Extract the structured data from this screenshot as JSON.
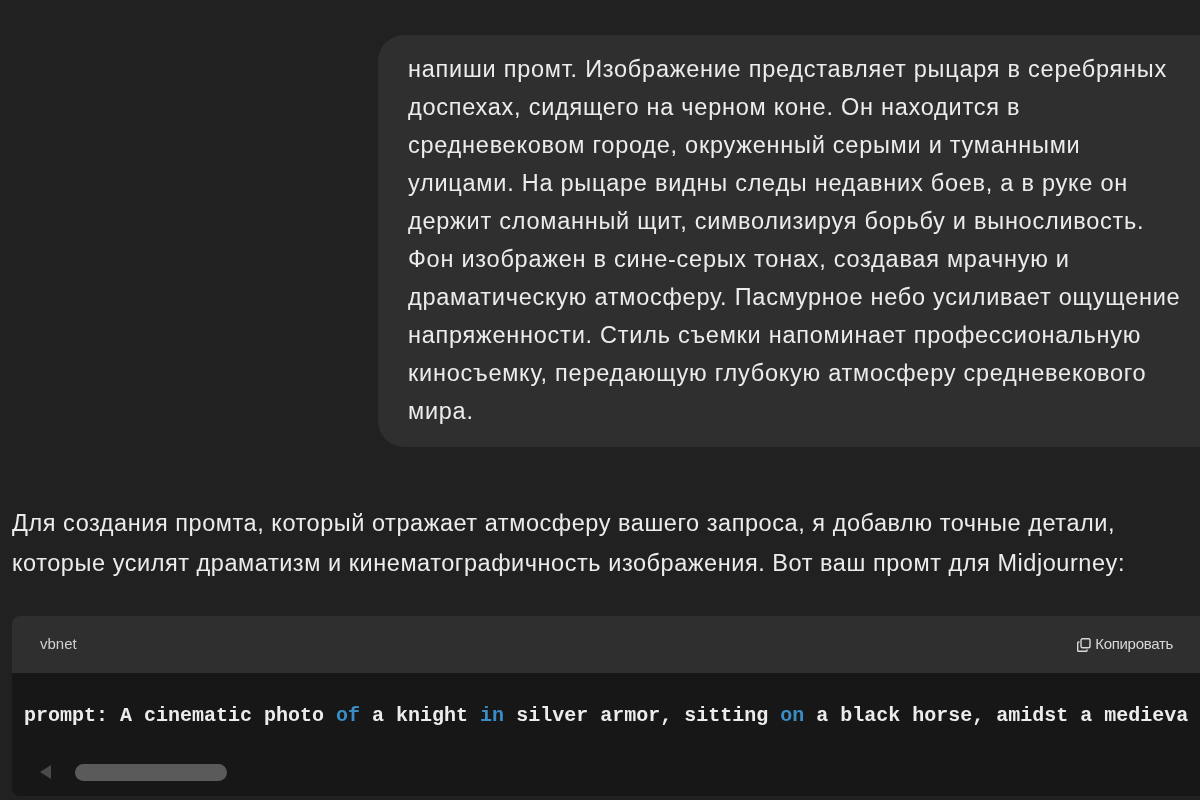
{
  "user_message": {
    "text": "напиши промт. Изображение представляет рыцаря в серебряных доспехах, сидящего на черном коне. Он находится в средневековом городе, окруженный серыми и туманными улицами. На рыцаре видны следы недавних боев, а в руке он держит сломанный щит, символизируя борьбу и выносливость. Фон изображен в сине-серых тонах, создавая мрачную и драматическую атмосферу. Пасмурное небо усиливает ощущение напряженности. Стиль съемки напоминает профессиональную киносъемку, передающую глубокую атмосферу средневекового мира."
  },
  "assistant_message": {
    "text": "Для создания промта, который отражает атмосферу вашего запроса, я добавлю точные детали, которые усилят драматизм и кинематографичность изображения. Вот ваш промт для Midjourney:",
    "code_block": {
      "language": "vbnet",
      "copy_label": "Копировать",
      "tokens": [
        {
          "text": "prompt: A cinematic photo ",
          "kind": "plain"
        },
        {
          "text": "of",
          "kind": "keyword"
        },
        {
          "text": " a knight ",
          "kind": "plain"
        },
        {
          "text": "in",
          "kind": "keyword"
        },
        {
          "text": " silver armor, sitting ",
          "kind": "plain"
        },
        {
          "text": "on",
          "kind": "keyword"
        },
        {
          "text": " a black horse, amidst a medieva",
          "kind": "plain"
        }
      ]
    }
  }
}
